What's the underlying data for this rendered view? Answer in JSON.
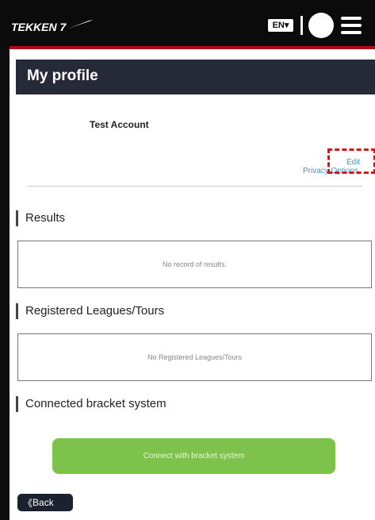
{
  "header": {
    "logo_text": "TEKKEN 7",
    "language": "EN",
    "language_caret": "▾"
  },
  "profile": {
    "page_title": "My profile",
    "account_name": "Test Account",
    "edit_link": "Edit",
    "privacy_link": "Privacy Options"
  },
  "sections": {
    "results": {
      "title": "Results",
      "empty_text": "No record of results."
    },
    "leagues": {
      "title": "Registered Leagues/Tours",
      "empty_text": "No Registered Leagues/Tours"
    },
    "bracket": {
      "title": "Connected bracket system",
      "button": "Connect with bracket system"
    }
  },
  "back_button": {
    "icon": "《",
    "label": "Back"
  },
  "colors": {
    "accent_red": "#b0081a",
    "header_bg": "#262a38",
    "link": "#4a90c8",
    "connect_green": "#7dc24b"
  }
}
